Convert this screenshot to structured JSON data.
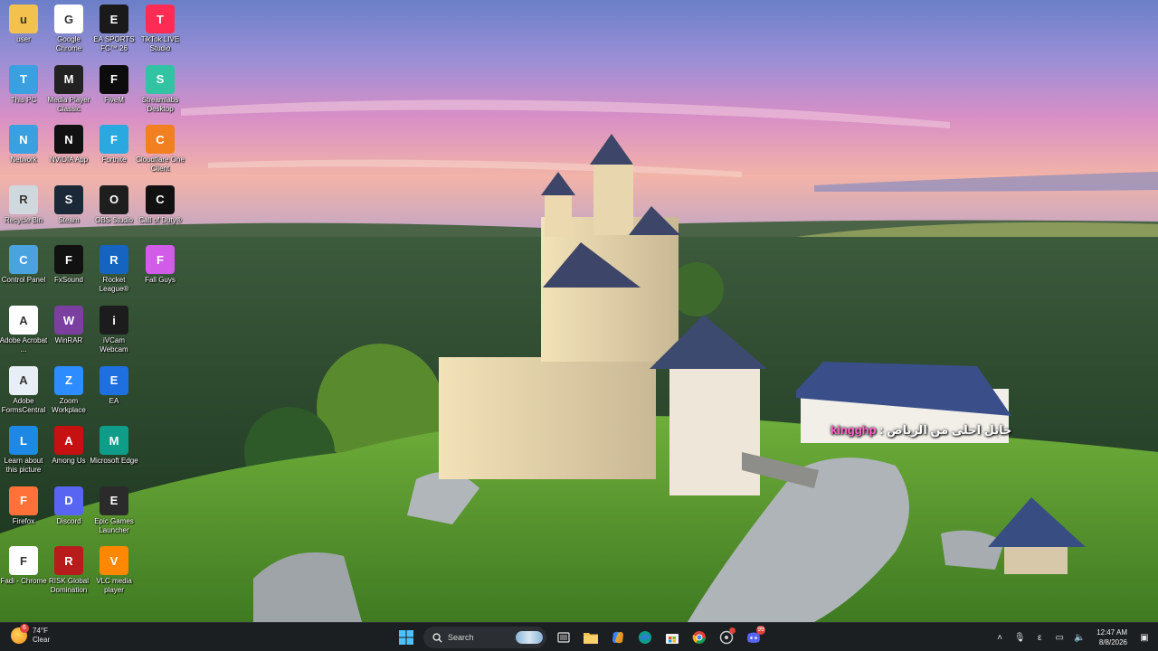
{
  "desktop": {
    "columns": [
      [
        {
          "label": "user",
          "icon": "folder-icon",
          "color": "#f2c14e"
        },
        {
          "label": "This PC",
          "icon": "monitor-icon",
          "color": "#3aa0e0"
        },
        {
          "label": "Network",
          "icon": "network-icon",
          "color": "#3aa0e0"
        },
        {
          "label": "Recycle Bin",
          "icon": "recycle-bin-icon",
          "color": "#cfd8dc"
        },
        {
          "label": "Control Panel",
          "icon": "control-panel-icon",
          "color": "#4aa3df"
        },
        {
          "label": "Adobe Acrobat ...",
          "icon": "adobe-acrobat-icon",
          "color": "#ffffff"
        },
        {
          "label": "Adobe FormsCentral",
          "icon": "document-icon",
          "color": "#e8eef5"
        },
        {
          "label": "Learn about this picture",
          "icon": "picture-icon",
          "color": "#1e88e5"
        },
        {
          "label": "Firefox",
          "icon": "firefox-icon",
          "color": "#ff7139"
        },
        {
          "label": "Fadi - Chrome",
          "icon": "chrome-icon",
          "color": "#ffffff"
        }
      ],
      [
        {
          "label": "Google Chrome",
          "icon": "chrome-icon",
          "color": "#ffffff"
        },
        {
          "label": "Media Player Classic",
          "icon": "media-player-icon",
          "color": "#222222"
        },
        {
          "label": "NVIDIA App",
          "icon": "nvidia-icon",
          "color": "#111111"
        },
        {
          "label": "Steam",
          "icon": "steam-icon",
          "color": "#1b2838"
        },
        {
          "label": "FxSound",
          "icon": "fxsound-icon",
          "color": "#111111"
        },
        {
          "label": "WinRAR",
          "icon": "winrar-icon",
          "color": "#7b3fa0"
        },
        {
          "label": "Zoom Workplace",
          "icon": "zoom-icon",
          "color": "#2d8cff"
        },
        {
          "label": "Among Us",
          "icon": "among-us-icon",
          "color": "#c51111"
        },
        {
          "label": "Discord",
          "icon": "discord-icon",
          "color": "#5865f2"
        },
        {
          "label": "RISK Global Domination",
          "icon": "risk-icon",
          "color": "#b71c1c"
        }
      ],
      [
        {
          "label": "EA SPORTS FC™ 26",
          "icon": "ea-fc-icon",
          "color": "#1a1a1a"
        },
        {
          "label": "FiveM",
          "icon": "fivem-icon",
          "color": "#0c0c0c"
        },
        {
          "label": "Fortnite",
          "icon": "fortnite-icon",
          "color": "#2aa9e0"
        },
        {
          "label": "OBS Studio",
          "icon": "obs-icon",
          "color": "#1e1e1e"
        },
        {
          "label": "Rocket League®",
          "icon": "rocket-league-icon",
          "color": "#1565c0"
        },
        {
          "label": "iVCam Webcam",
          "icon": "webcam-icon",
          "color": "#1c1c1c"
        },
        {
          "label": "EA",
          "icon": "ea-icon",
          "color": "#1e6fe0"
        },
        {
          "label": "Microsoft Edge",
          "icon": "edge-icon",
          "color": "#0f9d8a"
        },
        {
          "label": "Epic Games Launcher",
          "icon": "epic-games-icon",
          "color": "#2b2b2b"
        },
        {
          "label": "VLC media player",
          "icon": "vlc-icon",
          "color": "#ff8800"
        }
      ],
      [
        {
          "label": "TikTok LIVE Studio",
          "icon": "tiktok-icon",
          "color": "#fe2c55"
        },
        {
          "label": "Streamlabs Desktop",
          "icon": "streamlabs-icon",
          "color": "#31c3a2"
        },
        {
          "label": "Cloudflare One Client",
          "icon": "cloudflare-icon",
          "color": "#f38020"
        },
        {
          "label": "Call of Duty®",
          "icon": "call-of-duty-icon",
          "color": "#111111"
        },
        {
          "label": "Fall Guys",
          "icon": "fall-guys-icon",
          "color": "#d15ce8"
        }
      ]
    ]
  },
  "overlay": {
    "prefix": "حابل احلى من الرياض : ",
    "user": "kingghp"
  },
  "taskbar": {
    "weather": {
      "temp": "74°F",
      "condition": "Clear",
      "badge": "6"
    },
    "search_placeholder": "Search",
    "discord_badge": "99",
    "tray": {
      "time": "12:47 AM",
      "date": "8/8/2026",
      "lang": "ε"
    }
  }
}
